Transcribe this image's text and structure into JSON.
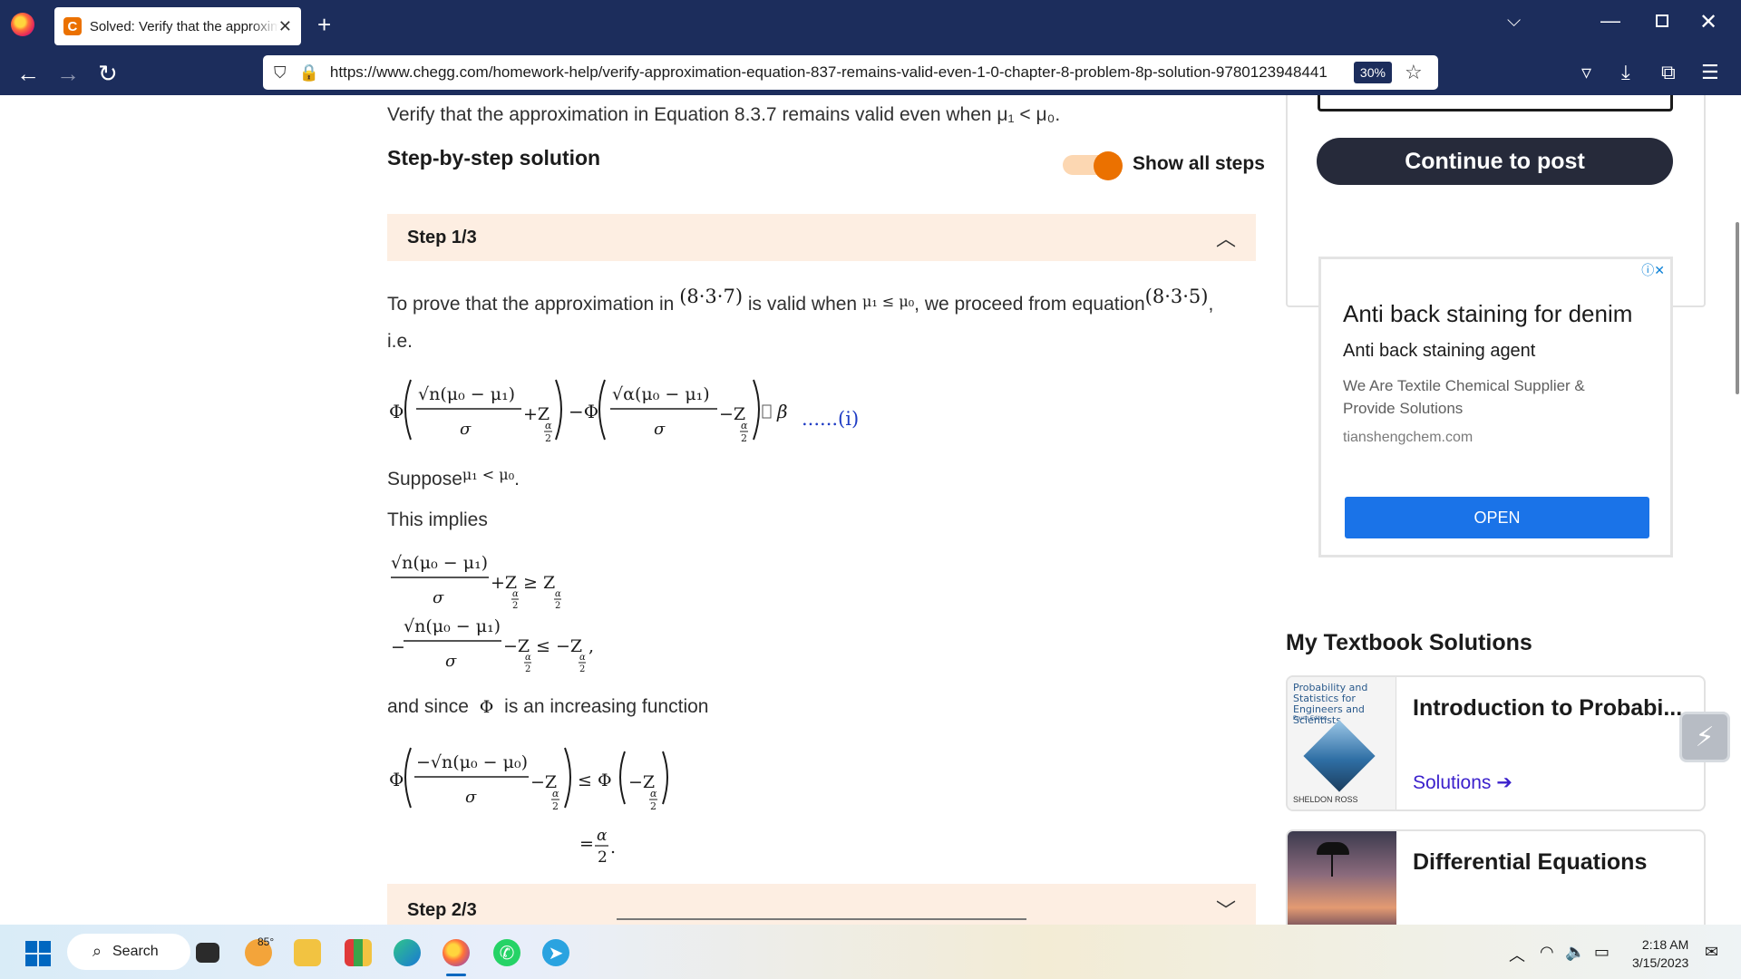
{
  "browser": {
    "tab_title": "Solved: Verify that the approxim",
    "tab_favicon": "C",
    "url": "https://www.chegg.com/homework-help/verify-approximation-equation-837-remains-valid-even-1-0-chapter-8-problem-8p-solution-9780123948441",
    "zoom": "30%"
  },
  "question": {
    "text": "Verify that the approximation in Equation 8.3.7 remains valid even when μ₁ < μ₀."
  },
  "solution": {
    "heading": "Step-by-step solution",
    "toggle_label": "Show all steps",
    "toggle_on": true,
    "step1_label": "Step 1/3",
    "step2_label": "Step 2/3",
    "p1_a": "To prove that the approximation in",
    "p1_ref1": "(8·3·7)",
    "p1_b": "is valid when",
    "p1_cond": "μ₁ ≤ μ₀",
    "p1_c": ", we proceed from equation",
    "p1_ref2": "(8·3·5)",
    "p1_d": ",",
    "p1_ie": "i.e.",
    "eq_i_label": "......(i)",
    "suppose_word": "Suppose",
    "suppose_cond": "μ₁ < μ₀",
    "suppose_end": ".",
    "implies": "This implies",
    "since_a": "and since",
    "since_phi": "Φ",
    "since_b": "is an increasing function"
  },
  "sidebar": {
    "continue_button": "Continue to post",
    "ad": {
      "title": "Anti back staining for denim",
      "subtitle": "Anti back staining agent",
      "description": "We Are Textile Chemical Supplier & Provide Solutions",
      "domain": "tianshengchem.com",
      "cta": "OPEN"
    },
    "my_textbook_heading": "My Textbook Solutions",
    "books": [
      {
        "title": "Introduction to Probabi...",
        "link": "Solutions ➔",
        "cover_title": "Probability and Statistics for Engineers and Scientists",
        "cover_edition": "Fourth Edition",
        "cover_author": "SHELDON ROSS"
      },
      {
        "title": "Differential Equations"
      }
    ]
  },
  "taskbar": {
    "search_label": "Search",
    "weather": "85°",
    "time": "2:18 AM",
    "date": "3/15/2023"
  }
}
